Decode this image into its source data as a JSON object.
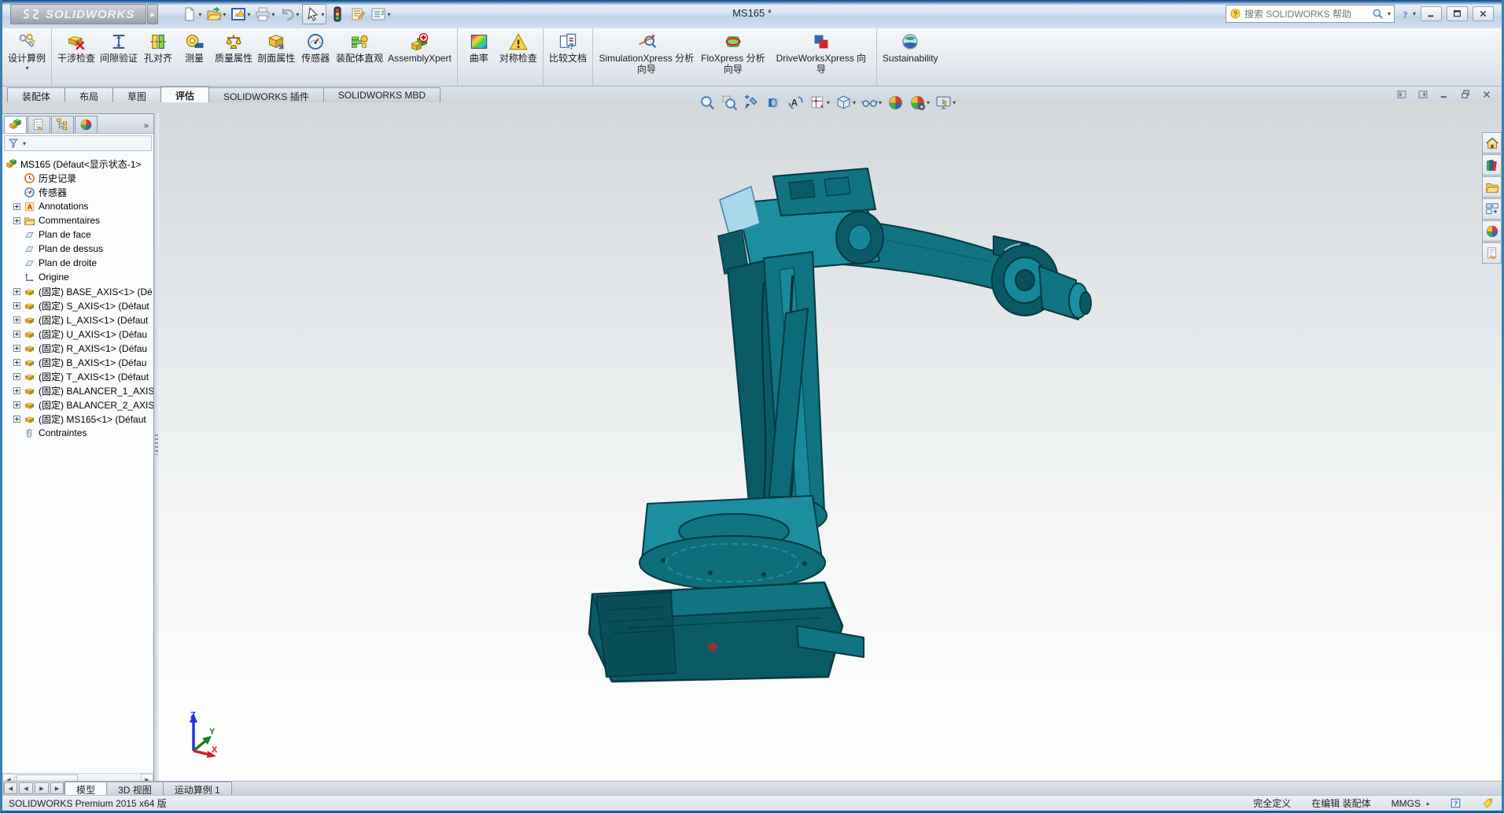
{
  "icons": {
    "caret_down": "▾",
    "caret_up": "▴",
    "chevron_expand": "»",
    "play": "▶",
    "nav_prev": "◀",
    "nav_next": "▶"
  },
  "titlebar": {
    "brand": "SOLIDWORKS",
    "title": "MS165 *",
    "search_placeholder": "搜索 SOLIDWORKS 帮助",
    "quick_icons": [
      "new-document",
      "open",
      "publish-edrawings",
      "print",
      "undo",
      "select",
      "rebuild-traffic-light",
      "file-properties",
      "options"
    ]
  },
  "ribbon": {
    "design_study": "设计算例",
    "buttons": [
      "干涉检查",
      "间隙验证",
      "孔对齐",
      "测量",
      "质量属性",
      "剖面属性",
      "传感器",
      "装配体直观",
      "AssemblyXpert",
      "曲率",
      "对称检查",
      "比较文档",
      "SimulationXpress 分析向导",
      "FloXpress 分析向导",
      "DriveWorksXpress 向导",
      "Sustainability"
    ]
  },
  "command_tabs": {
    "items": [
      "装配体",
      "布局",
      "草图",
      "评估",
      "SOLIDWORKS 插件",
      "SOLIDWORKS MBD"
    ],
    "active": "评估"
  },
  "feature_panel": {
    "tabs": [
      "featuremanager",
      "propertymanager",
      "configurationmanager",
      "displaymanager"
    ],
    "tree": [
      {
        "label": "MS165  (Défaut<显示状态-1>"
      },
      {
        "label": "历史记录"
      },
      {
        "label": "传感器"
      },
      {
        "label": "Annotations"
      },
      {
        "label": "Commentaires"
      },
      {
        "label": "Plan de face"
      },
      {
        "label": "Plan de dessus"
      },
      {
        "label": "Plan de droite"
      },
      {
        "label": "Origine"
      },
      {
        "label": "(固定) BASE_AXIS<1> (Dé"
      },
      {
        "label": "(固定) S_AXIS<1> (Défaut"
      },
      {
        "label": "(固定) L_AXIS<1> (Défaut"
      },
      {
        "label": "(固定) U_AXIS<1> (Défau"
      },
      {
        "label": "(固定) R_AXIS<1> (Défau"
      },
      {
        "label": "(固定) B_AXIS<1> (Défau"
      },
      {
        "label": "(固定) T_AXIS<1> (Défaut"
      },
      {
        "label": "(固定) BALANCER_1_AXIS"
      },
      {
        "label": "(固定) BALANCER_2_AXIS"
      },
      {
        "label": "(固定) MS165<1> (Défaut"
      },
      {
        "label": "Contraintes"
      }
    ]
  },
  "headsup_icons": [
    "zoom-fit",
    "zoom-area",
    "previous-view",
    "section-view",
    "annotation-view",
    "view-orientation",
    "display-style",
    "hide-show-items",
    "edit-appearance",
    "apply-scene",
    "view-settings"
  ],
  "taskpane_icons": [
    "resources-home",
    "design-library",
    "file-explorer",
    "view-palette",
    "appearances-scenes",
    "custom-properties"
  ],
  "viewport": {
    "triad": {
      "x": "X",
      "y": "Y",
      "z": "Z"
    }
  },
  "bottom_tabs": {
    "items": [
      "模型",
      "3D 视图",
      "运动算例 1"
    ],
    "active": "模型"
  },
  "statusbar": {
    "product": "SOLIDWORKS Premium 2015 x64 版",
    "constraint_state": "完全定义",
    "edit_state": "在编辑 装配体",
    "units": "MMGS"
  }
}
